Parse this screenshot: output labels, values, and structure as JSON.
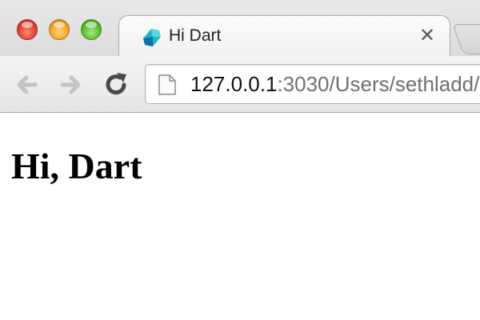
{
  "window": {
    "traffic_lights": [
      "close-button",
      "minimize-button",
      "maximize-button"
    ]
  },
  "tab": {
    "title": "Hi Dart",
    "close_glyph": "✕",
    "favicon": "dart-logo-icon"
  },
  "toolbar": {
    "back_icon": "back-arrow-icon",
    "forward_icon": "forward-arrow-icon",
    "reload_icon": "reload-icon"
  },
  "address_bar": {
    "url_host": "127.0.0.1",
    "url_rest": ":3030/Users/sethladd/",
    "page_icon": "page-icon"
  },
  "page": {
    "heading": "Hi, Dart"
  },
  "colors": {
    "dart_teal": "#1fb7c6",
    "dart_blue": "#0d6fa8"
  }
}
